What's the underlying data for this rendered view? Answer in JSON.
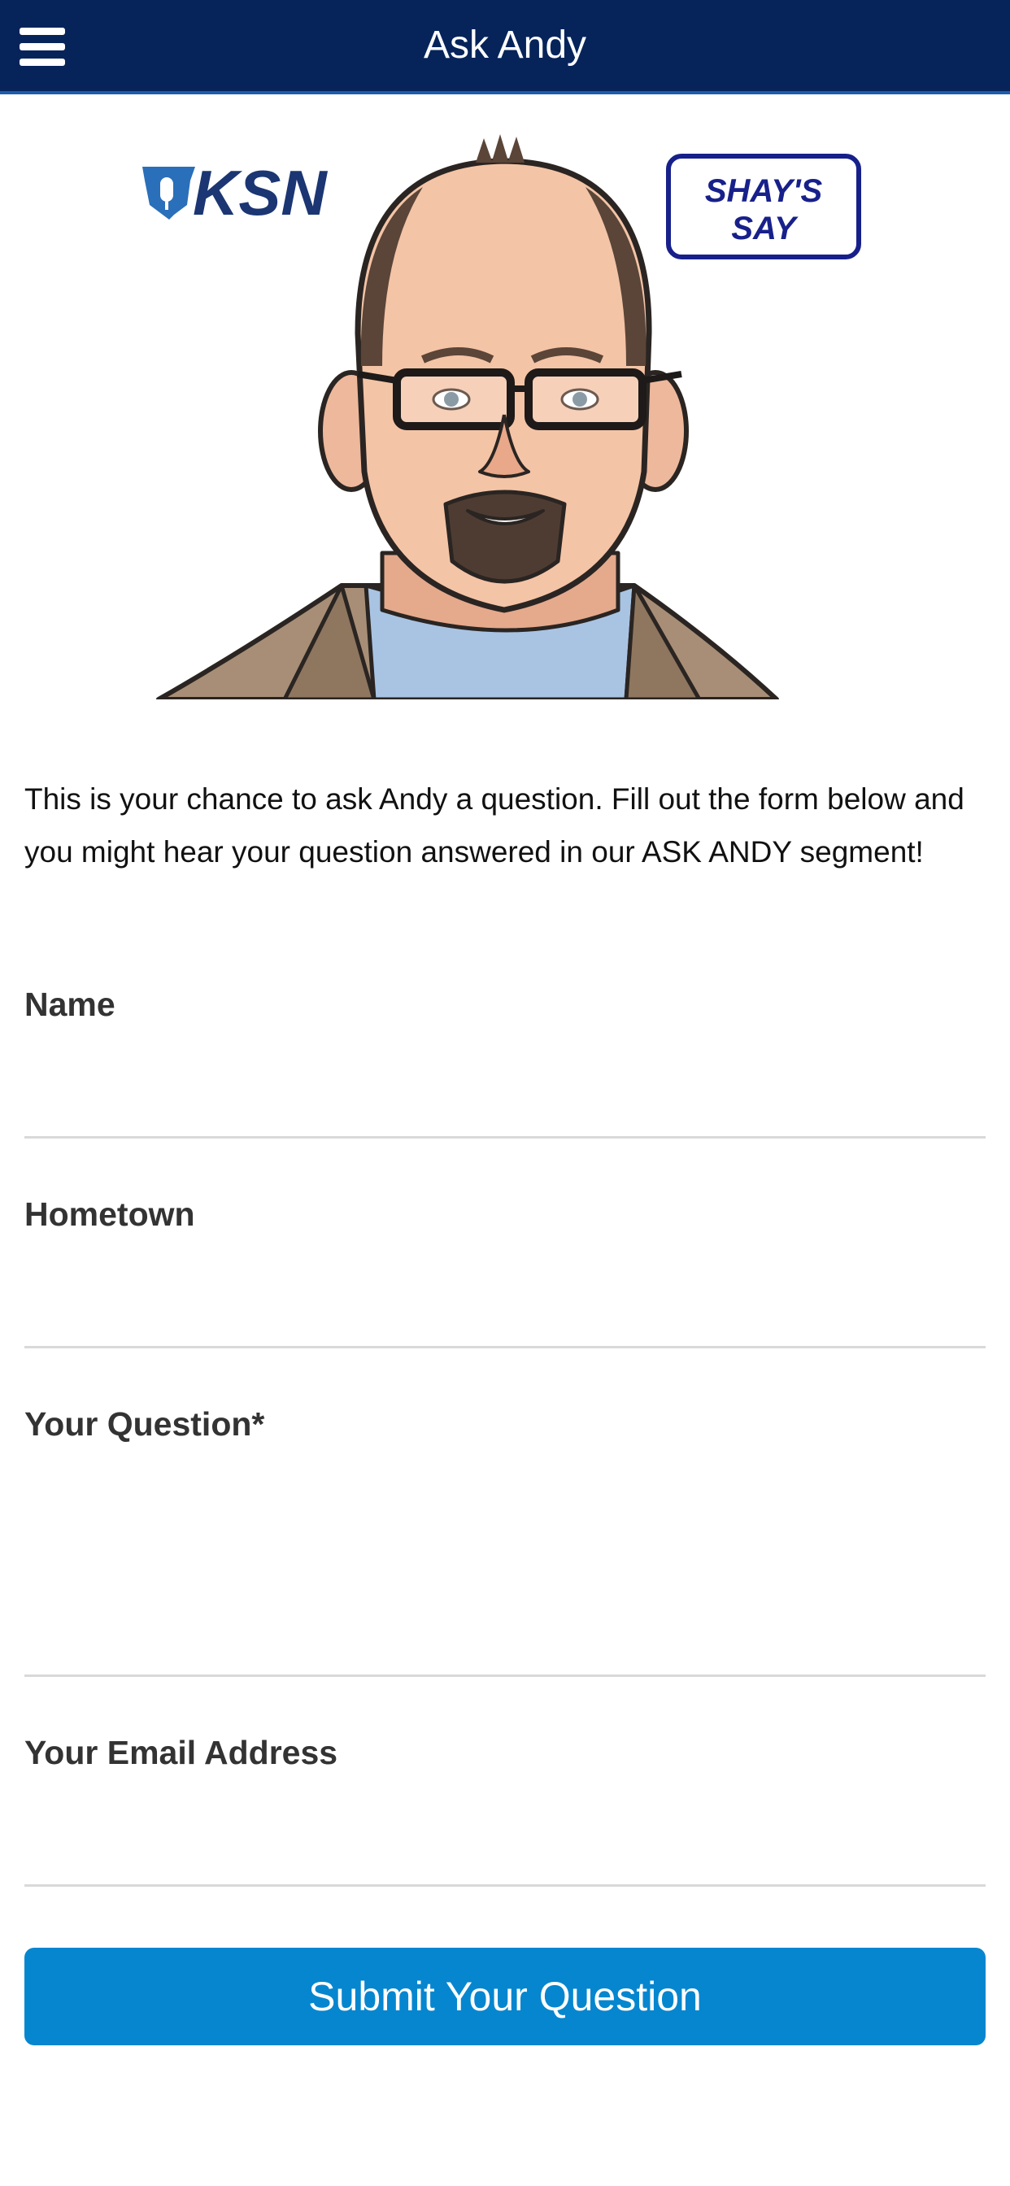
{
  "header": {
    "title": "Ask Andy"
  },
  "hero": {
    "ksn_logo_text": "KSN",
    "shays_say_line1": "SHAY'S",
    "shays_say_line2": "SAY"
  },
  "intro": {
    "text": "This is your chance to ask Andy a question. Fill out the form below and you might hear your question answered in our ASK ANDY segment!"
  },
  "form": {
    "name_label": "Name",
    "name_value": "",
    "hometown_label": "Hometown",
    "hometown_value": "",
    "question_label": "Your Question*",
    "question_value": "",
    "email_label": "Your Email Address",
    "email_value": "",
    "submit_label": "Submit Your Question"
  },
  "colors": {
    "header_bg": "#06245a",
    "header_border": "#1f5cad",
    "button_bg": "#0686cf"
  }
}
